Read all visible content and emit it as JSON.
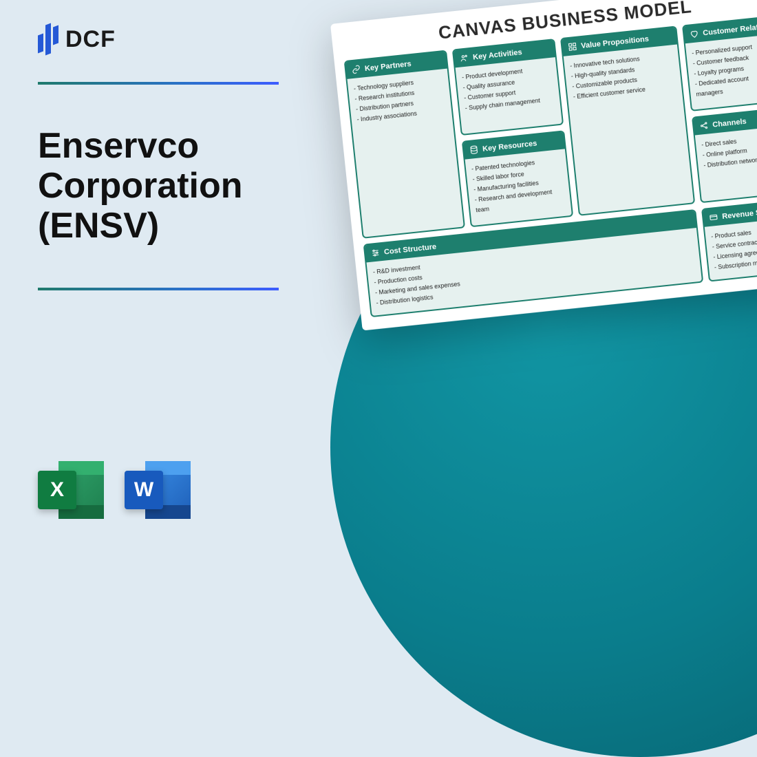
{
  "logo": {
    "text": "DCF"
  },
  "title": "Enservco Corporation (ENSV)",
  "icons": {
    "excel": "X",
    "word": "W"
  },
  "canvas": {
    "title": "CANVAS BUSINESS MODEL",
    "blocks": {
      "key_partners": {
        "label": "Key Partners",
        "items": [
          "Technology suppliers",
          "Research institutions",
          "Distribution partners",
          "Industry associations"
        ]
      },
      "key_activities": {
        "label": "Key Activities",
        "items": [
          "Product development",
          "Quality assurance",
          "Customer support",
          "Supply chain management"
        ]
      },
      "key_resources": {
        "label": "Key Resources",
        "items": [
          "Patented technologies",
          "Skilled labor force",
          "Manufacturing facilities",
          "Research and development team"
        ]
      },
      "value_propositions": {
        "label": "Value Propositions",
        "items": [
          "Innovative tech solutions",
          "High-quality standards",
          "Customizable products",
          "Efficient customer service"
        ]
      },
      "customer_relationships": {
        "label": "Customer Relationships",
        "items": [
          "Personalized support",
          "Customer feedback",
          "Loyalty programs",
          "Dedicated account managers"
        ]
      },
      "channels": {
        "label": "Channels",
        "items": [
          "Direct sales",
          "Online platform",
          "Distribution network"
        ]
      },
      "cost_structure": {
        "label": "Cost Structure",
        "items": [
          "R&D investment",
          "Production costs",
          "Marketing and sales expenses",
          "Distribution logistics"
        ]
      },
      "revenue_streams": {
        "label": "Revenue Streams",
        "items": [
          "Product sales",
          "Service contracts",
          "Licensing agreements",
          "Subscription models"
        ]
      }
    }
  }
}
